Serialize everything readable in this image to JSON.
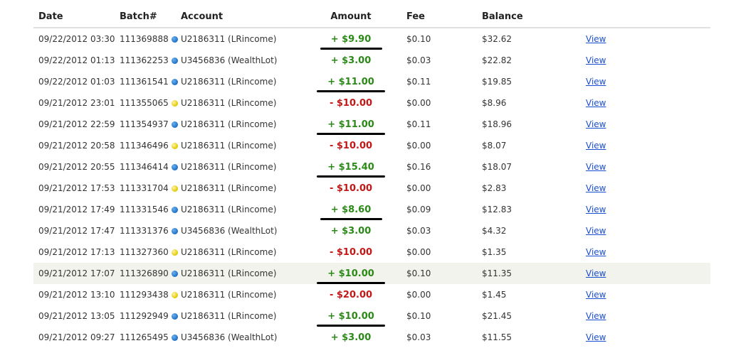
{
  "table": {
    "headers": {
      "date": "Date",
      "batch": "Batch#",
      "account": "Account",
      "amount": "Amount",
      "fee": "Fee",
      "balance": "Balance"
    },
    "rows": [
      {
        "date": "09/22/2012 03:30",
        "batch": "111369888",
        "status": "blue",
        "account": "U2186311 (LRincome)",
        "amount": "+ $9.90",
        "sign": "pos",
        "fee": "$0.10",
        "balance": "$32.62",
        "link": "View",
        "underlined": true
      },
      {
        "date": "09/22/2012 01:13",
        "batch": "111362253",
        "status": "blue",
        "account": "U3456836 (WealthLot)",
        "amount": "+ $3.00",
        "sign": "pos",
        "fee": "$0.03",
        "balance": "$22.82",
        "link": "View",
        "underlined": false
      },
      {
        "date": "09/22/2012 01:03",
        "batch": "111361541",
        "status": "blue",
        "account": "U2186311 (LRincome)",
        "amount": "+ $11.00",
        "sign": "pos",
        "fee": "$0.11",
        "balance": "$19.85",
        "link": "View",
        "underlined": true
      },
      {
        "date": "09/21/2012 23:01",
        "batch": "111355065",
        "status": "yellow",
        "account": "U2186311 (LRincome)",
        "amount": "- $10.00",
        "sign": "neg",
        "fee": "$0.00",
        "balance": "$8.96",
        "link": "View",
        "underlined": false
      },
      {
        "date": "09/21/2012 22:59",
        "batch": "111354937",
        "status": "blue",
        "account": "U2186311 (LRincome)",
        "amount": "+ $11.00",
        "sign": "pos",
        "fee": "$0.11",
        "balance": "$18.96",
        "link": "View",
        "underlined": true
      },
      {
        "date": "09/21/2012 20:58",
        "batch": "111346496",
        "status": "yellow",
        "account": "U2186311 (LRincome)",
        "amount": "- $10.00",
        "sign": "neg",
        "fee": "$0.00",
        "balance": "$8.07",
        "link": "View",
        "underlined": false
      },
      {
        "date": "09/21/2012 20:55",
        "batch": "111346414",
        "status": "blue",
        "account": "U2186311 (LRincome)",
        "amount": "+ $15.40",
        "sign": "pos",
        "fee": "$0.16",
        "balance": "$18.07",
        "link": "View",
        "underlined": true
      },
      {
        "date": "09/21/2012 17:53",
        "batch": "111331704",
        "status": "yellow",
        "account": "U2186311 (LRincome)",
        "amount": "- $10.00",
        "sign": "neg",
        "fee": "$0.00",
        "balance": "$2.83",
        "link": "View",
        "underlined": false
      },
      {
        "date": "09/21/2012 17:49",
        "batch": "111331546",
        "status": "blue",
        "account": "U2186311 (LRincome)",
        "amount": "+ $8.60",
        "sign": "pos",
        "fee": "$0.09",
        "balance": "$12.83",
        "link": "View",
        "underlined": true
      },
      {
        "date": "09/21/2012 17:47",
        "batch": "111331376",
        "status": "blue",
        "account": "U3456836 (WealthLot)",
        "amount": "+ $3.00",
        "sign": "pos",
        "fee": "$0.03",
        "balance": "$4.32",
        "link": "View",
        "underlined": false
      },
      {
        "date": "09/21/2012 17:13",
        "batch": "111327360",
        "status": "yellow",
        "account": "U2186311 (LRincome)",
        "amount": "- $10.00",
        "sign": "neg",
        "fee": "$0.00",
        "balance": "$1.35",
        "link": "View",
        "underlined": false
      },
      {
        "date": "09/21/2012 17:07",
        "batch": "111326890",
        "status": "blue",
        "account": "U2186311 (LRincome)",
        "amount": "+ $10.00",
        "sign": "pos",
        "fee": "$0.10",
        "balance": "$11.35",
        "link": "View",
        "underlined": true,
        "highlight": true
      },
      {
        "date": "09/21/2012 13:10",
        "batch": "111293438",
        "status": "yellow",
        "account": "U2186311 (LRincome)",
        "amount": "- $20.00",
        "sign": "neg",
        "fee": "$0.00",
        "balance": "$1.45",
        "link": "View",
        "underlined": false
      },
      {
        "date": "09/21/2012 13:05",
        "batch": "111292949",
        "status": "blue",
        "account": "U2186311 (LRincome)",
        "amount": "+ $10.00",
        "sign": "pos",
        "fee": "$0.10",
        "balance": "$21.45",
        "link": "View",
        "underlined": true
      },
      {
        "date": "09/21/2012 09:27",
        "batch": "111265495",
        "status": "blue",
        "account": "U3456836 (WealthLot)",
        "amount": "+ $3.00",
        "sign": "pos",
        "fee": "$0.03",
        "balance": "$11.55",
        "link": "View",
        "underlined": false
      }
    ]
  },
  "colors": {
    "positive": "#2b8a17",
    "negative": "#c41717",
    "link": "#1b4fd1",
    "status_blue": "#1d6fc6",
    "status_yellow": "#e0c800",
    "row_highlight": "#f2f3ec"
  }
}
